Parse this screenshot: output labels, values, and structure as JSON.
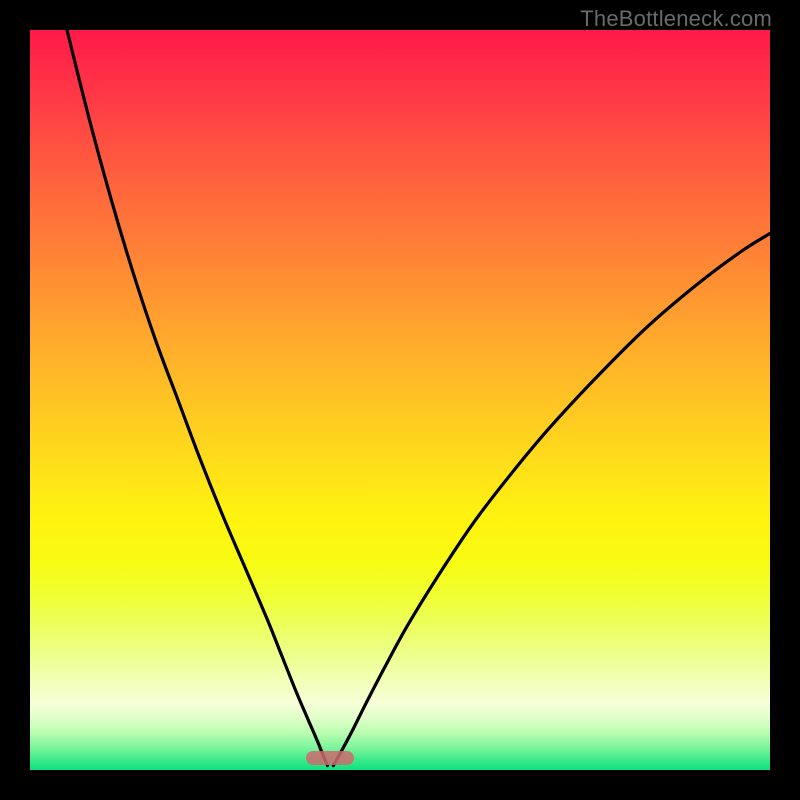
{
  "watermark": "TheBottleneck.com",
  "colors": {
    "curve": "#000000",
    "marker": "#cf6a6e"
  },
  "chart_data": {
    "type": "line",
    "title": "",
    "xlabel": "",
    "ylabel": "",
    "xlim": [
      0,
      100
    ],
    "ylim": [
      0,
      100
    ],
    "optimum_x": 40.5,
    "marker": {
      "x_center_pct": 40.5,
      "y_pct": 98.4,
      "width_pct": 6.5,
      "height_pct": 1.9
    },
    "series": [
      {
        "name": "left-branch",
        "x": [
          5.0,
          8.0,
          11.0,
          14.0,
          17.0,
          20.0,
          23.0,
          26.0,
          29.0,
          32.0,
          34.0,
          36.0,
          37.5,
          38.8,
          39.6,
          40.2
        ],
        "y": [
          100.0,
          88.0,
          77.0,
          67.0,
          58.0,
          50.0,
          42.0,
          34.5,
          27.5,
          20.5,
          15.5,
          10.5,
          7.0,
          4.0,
          2.0,
          0.6
        ]
      },
      {
        "name": "right-branch",
        "x": [
          41.0,
          42.0,
          43.5,
          45.5,
          48.0,
          51.0,
          55.0,
          60.0,
          65.0,
          70.0,
          76.0,
          83.0,
          90.0,
          96.0,
          100.0
        ],
        "y": [
          0.6,
          2.4,
          5.2,
          9.2,
          14.0,
          19.5,
          26.0,
          33.5,
          40.0,
          46.0,
          52.5,
          59.5,
          65.5,
          70.0,
          72.5
        ]
      }
    ]
  }
}
